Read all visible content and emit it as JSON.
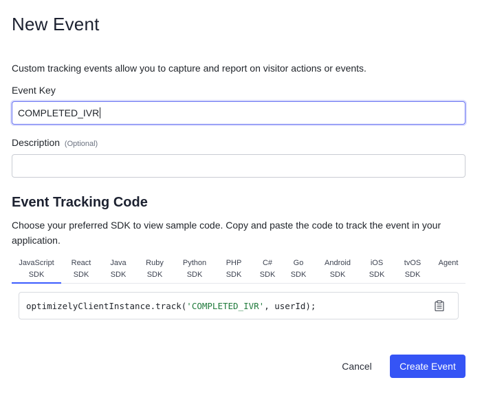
{
  "dialog": {
    "title": "New Event",
    "intro": "Custom tracking events allow you to capture and report on visitor actions or events."
  },
  "fields": {
    "event_key_label": "Event Key",
    "event_key_value": "COMPLETED_IVR",
    "description_label": "Description",
    "description_optional": "(Optional)",
    "description_value": ""
  },
  "tracking": {
    "heading": "Event Tracking Code",
    "description": "Choose your preferred SDK to view sample code. Copy and paste the code to track the event in your application.",
    "tabs": [
      {
        "line1": "JavaScript",
        "line2": "SDK"
      },
      {
        "line1": "React",
        "line2": "SDK"
      },
      {
        "line1": "Java",
        "line2": "SDK"
      },
      {
        "line1": "Ruby",
        "line2": "SDK"
      },
      {
        "line1": "Python",
        "line2": "SDK"
      },
      {
        "line1": "PHP",
        "line2": "SDK"
      },
      {
        "line1": "C#",
        "line2": "SDK"
      },
      {
        "line1": "Go",
        "line2": "SDK"
      },
      {
        "line1": "Android",
        "line2": "SDK"
      },
      {
        "line1": "iOS",
        "line2": "SDK"
      },
      {
        "line1": "tvOS",
        "line2": "SDK"
      },
      {
        "line1": "Agent",
        "line2": ""
      }
    ],
    "active_tab": "JavaScript SDK",
    "code_prefix": "optimizelyClientInstance.track(",
    "code_string": "'COMPLETED_IVR'",
    "code_suffix": ", userId);",
    "copy_icon": "clipboard-icon"
  },
  "actions": {
    "cancel_label": "Cancel",
    "create_label": "Create Event"
  },
  "colors": {
    "primary": "#3554f5",
    "active_tab_underline": "#3b5bff",
    "focus_border": "#6a75f2",
    "code_string": "#1f7a3b"
  }
}
